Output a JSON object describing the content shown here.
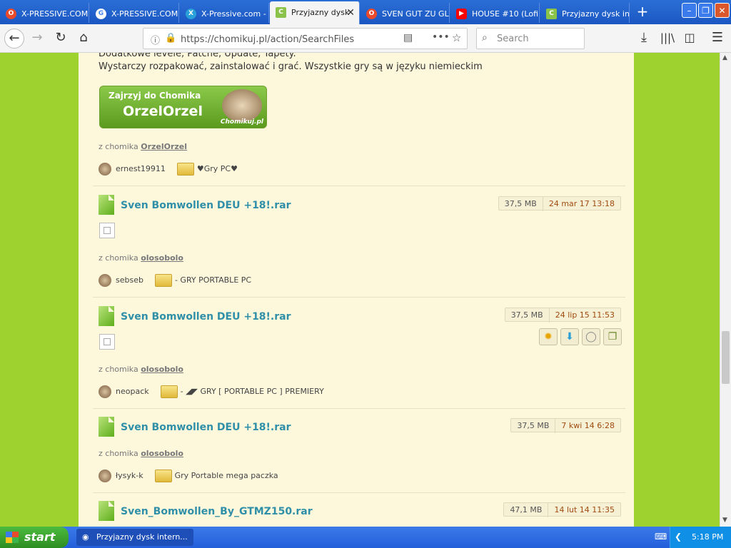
{
  "browser": {
    "tabs": [
      {
        "label": "X-PRESSIVE.COM",
        "icon": "opera-icon",
        "color": "#e94a2b",
        "active": false
      },
      {
        "label": "X-PRESSIVE.COM",
        "icon": "google-icon",
        "color": "#4285f4",
        "active": false
      },
      {
        "label": "X-Pressive.com -",
        "icon": "site-icon",
        "color": "#2aa0d8",
        "active": false
      },
      {
        "label": "Przyjazny dysk",
        "icon": "chomikuj-icon",
        "color": "#8bc34a",
        "active": true
      },
      {
        "label": "SVEN GUT ZU GLO",
        "icon": "opera-icon",
        "color": "#e94a2b",
        "active": false
      },
      {
        "label": "HOUSE #10 (Lofi",
        "icon": "youtube-icon",
        "color": "#ff0000",
        "active": false
      },
      {
        "label": "Przyjazny dysk in",
        "icon": "chomikuj-icon",
        "color": "#8bc34a",
        "active": false
      }
    ],
    "url": "https://chomikuj.pl/action/SearchFiles",
    "search_placeholder": "Search"
  },
  "page": {
    "intro_line1": "Dodatkowe levele, Patche, Update, Tapety.",
    "intro_line2": "Wystarczy rozpakować, zainstalować i grać. Wszystkie gry są w języku niemieckim",
    "banner": {
      "line1": "Zajrzyj do Chomika",
      "line2": "OrzelOrzel",
      "logo": "Chomikuj.pl"
    },
    "top_from_prefix": "z chomika",
    "top_from_user": "OrzelOrzel",
    "top_user": "ernest19911",
    "top_folder": "♥Gry PC♥",
    "entries": [
      {
        "name": "Sven Bomwollen DEU +18!.rar",
        "size": "37,5 MB",
        "date": "24 mar 17 13:18",
        "from_prefix": "z chomika",
        "from_user": "olosobolo",
        "user": "sebseb",
        "folder": "- GRY PORTABLE PC"
      },
      {
        "name": "Sven Bomwollen DEU +18!.rar",
        "size": "37,5 MB",
        "date": "24 lip 15 11:53",
        "from_prefix": "z chomika",
        "from_user": "olosobolo",
        "user": "neopack",
        "folder": "- ◢◤ GRY [ PORTABLE PC ] PREMIERY"
      },
      {
        "name": "Sven Bomwollen DEU +18!.rar",
        "size": "37,5 MB",
        "date": "7 kwi 14 6:28",
        "from_prefix": "z chomika",
        "from_user": "olosobolo",
        "user": "łysyk-k",
        "folder": "Gry Portable mega paczka"
      },
      {
        "name": "Sven_Bomwollen_By_GTMZ150.rar",
        "size": "47,1 MB",
        "date": "14 lut 14 11:35"
      }
    ],
    "action_icons": [
      "star-icon",
      "download-icon",
      "comment-icon",
      "copy-icon"
    ]
  },
  "taskbar": {
    "start_label": "start",
    "window_label": "Przyjazny dysk intern...",
    "clock": "5:18 PM"
  }
}
